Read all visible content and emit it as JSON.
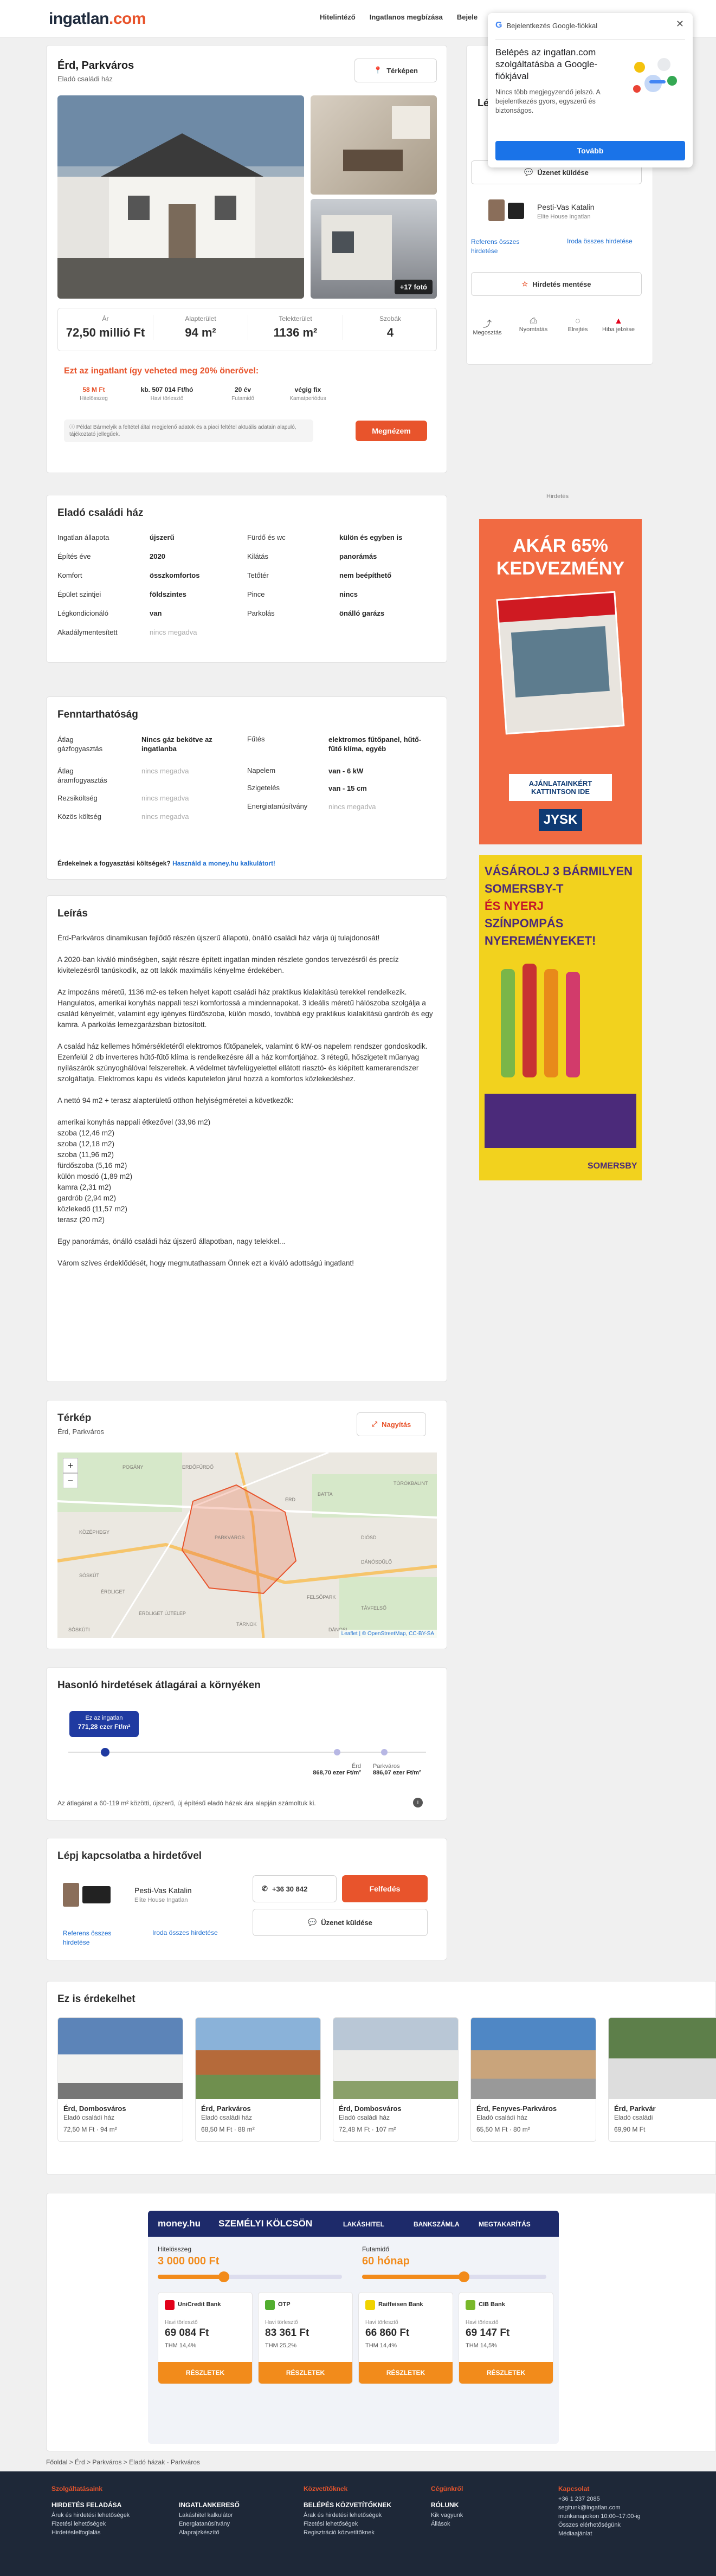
{
  "header": {
    "logo_main": "ingatlan",
    "logo_tld": ".com",
    "nav": [
      "Hitelintéző",
      "Ingatlanos megbízása",
      "Bejele"
    ]
  },
  "google_popup": {
    "brand": "Bejelentkezés Google-fiókkal",
    "title": "Belépés az ingatlan.com szolgáltatásba a Google-fiókjával",
    "body": "Nincs több megjegyzendő jelszó. A bejelentkezés gyors, egyszerű és biztonságos.",
    "button": "Tovább"
  },
  "listing": {
    "title": "Érd, Parkváros",
    "subtitle": "Eladó családi ház",
    "map_button": "Térképen",
    "more_photos": "+17 fotó",
    "stats": [
      {
        "label": "Ár",
        "value": "72,50 millió Ft"
      },
      {
        "label": "Alapterület",
        "value": "94 m²"
      },
      {
        "label": "Telekterület",
        "value": "1136 m²"
      },
      {
        "label": "Szobák",
        "value": "4"
      }
    ],
    "loan": {
      "headline": "Ezt az ingatlant így veheted meg 20% önerővel:",
      "items": [
        {
          "v": "58 M Ft",
          "l": "Hitelösszeg"
        },
        {
          "v": "kb. 507 014 Ft/hó",
          "l": "Havi törlesztő"
        },
        {
          "v": "20 év",
          "l": "Futamidő"
        },
        {
          "v": "végig fix",
          "l": "Kamatperiódus"
        }
      ],
      "note": "Példa! Bármelyik a feltétel által megjelenő adatok és a piaci feltétel aktuális adatain alapuló, tájékoztató jellegűek.",
      "button": "Megnézem"
    }
  },
  "sidebar": {
    "title": "Lépj",
    "message_button": "Üzenet küldése",
    "agent_name": "Pesti-Vas Katalin",
    "agent_company": "Elite House Ingatlan",
    "link_all": "Referens összes hirdetése",
    "link_office": "Iroda összes hirdetése",
    "save_button": "Hirdetés mentése",
    "actions": [
      "Megosztás",
      "Nyomtatás",
      "Elrejtés",
      "Hiba jelzése"
    ],
    "ad_label": "Hirdetés"
  },
  "ads": {
    "jysk_top": "AKÁR 65%",
    "jysk_sub": "KEDVEZMÉNY",
    "jysk_btn": "AJÁNLATAINKÉRT KATTINTSON IDE",
    "jysk_logo": "JYSK",
    "somersby_lines": [
      "VÁSÁROLJ 3 BÁRMILYEN",
      "SOMERSBY-T",
      "ÉS NYERJ",
      "SZÍNPOMPÁS",
      "NYEREMÉNYEKET!"
    ],
    "somersby_logo": "SOMERSBY"
  },
  "details": {
    "title": "Eladó családi ház",
    "left": [
      [
        "Ingatlan állapota",
        "újszerű"
      ],
      [
        "Építés éve",
        "2020"
      ],
      [
        "Komfort",
        "összkomfortos"
      ],
      [
        "Épület szintjei",
        "földszintes"
      ],
      [
        "Légkondicionáló",
        "van"
      ],
      [
        "Akadálymentesített",
        "nincs megadva"
      ]
    ],
    "right": [
      [
        "Fürdő és wc",
        "külön és egyben is"
      ],
      [
        "Kilátás",
        "panorámás"
      ],
      [
        "Tetőtér",
        "nem beépíthető"
      ],
      [
        "Pince",
        "nincs"
      ],
      [
        "Parkolás",
        "önálló garázs"
      ]
    ]
  },
  "maint": {
    "title": "Fenntarthatóság",
    "left": [
      [
        "Átlag gázfogyasztás",
        "Nincs gáz bekötve az ingatlanba"
      ],
      [
        "Átlag áramfogyasztás",
        "nincs megadva"
      ],
      [
        "Rezsiköltség",
        "nincs megadva"
      ],
      [
        "Közös költség",
        "nincs megadva"
      ]
    ],
    "right": [
      [
        "Fűtés",
        "elektromos fűtőpanel, hűtő-fűtő klíma, egyéb"
      ],
      [
        "Napelem",
        "van - 6 kW"
      ],
      [
        "Szigetelés",
        "van - 15 cm"
      ],
      [
        "Energiatanúsítvány",
        "nincs megadva"
      ]
    ],
    "q": "Érdekelnek a fogyasztási költségek?",
    "qlink": "Használd a money.hu kalkulátort!"
  },
  "description": {
    "title": "Leírás",
    "paras": [
      "Érd-Parkváros dinamikusan fejlődő részén újszerű állapotú, önálló családi ház várja új tulajdonosát!",
      "A 2020-ban kiváló minőségben, saját részre épített ingatlan minden részlete gondos tervezésről és precíz kivitelezésről tanúskodik, az ott lakók maximális kényelme érdekében.",
      "Az impozáns méretű, 1136 m2-es telken helyet kapott családi ház praktikus kialakítású terekkel rendelkezik. Hangulatos, amerikai konyhás nappali teszi komfortossá a mindennapokat. 3 ideális méretű hálószoba szolgálja a család kényelmét, valamint egy igényes fürdőszoba, külön mosdó, továbbá egy praktikus kialakítású gardrób és egy kamra. A parkolás lemezgarázsban biztosított.",
      "A család ház kellemes hőmérsékletéről elektromos fűtőpanelek, valamint 6 kW-os napelem rendszer gondoskodik. Ezenfelül 2 db inverteres hűtő-fűtő klíma is rendelkezésre áll a ház komfortjához. 3 rétegű, hőszigetelt műanyag nyílászárók szúnyoghálóval felszereltek. A védelmet távfelügyelettel ellátott riasztó- és kiépített kamerarendszer szolgáltatja. Elektromos kapu és videós kaputelefon járul hozzá a komfortos közlekedéshez.",
      "A nettó 94 m2 + terasz alapterületű otthon helyiségméretei a következők:"
    ],
    "rooms": [
      "amerikai konyhás nappali étkezővel (33,96 m2)",
      "szoba (12,46 m2)",
      "szoba (12,18 m2)",
      "szoba (11,96 m2)",
      "fürdőszoba (5,16 m2)",
      "külön mosdó (1,89 m2)",
      "kamra (2,31 m2)",
      "gardrób (2,94 m2)",
      "közlekedő (11,57 m2)",
      "terasz (20 m2)"
    ],
    "end": [
      "Egy panorámás, önálló családi ház újszerű állapotban, nagy telekkel...",
      "Várom szíves érdeklődését, hogy megmutathassam Önnek ezt a kiváló adottságú ingatlant!"
    ]
  },
  "map": {
    "title": "Térkép",
    "sub": "Érd, Parkváros",
    "button": "Nagyítás",
    "labels": [
      "PARKVÁROS",
      "ÉRD",
      "SÓSKÚT",
      "TÁRNOK",
      "BATTA",
      "DIÓSD",
      "DÁNÓSDŰLŐ",
      "ÉRDLIGET",
      "TÖRÖKBÁLINT",
      "ÉRDLIGET ÚJTELEP",
      "FELSŐPARK",
      "TÁVFELSŐ",
      "POGÁNY",
      "KÖZÉPHEGY",
      "ERDŐFÜRDŐ",
      "DÁNOSI",
      "SÓSKÚTI"
    ],
    "attribution": "Leaflet | © OpenStreetMap, CC-BY-SA"
  },
  "similar_price": {
    "title": "Hasonló hirdetések átlagárai a környéken",
    "tag1": "Ez az ingatlan",
    "tag2": "771,28 ezer Ft/m²",
    "p1_label": "Érd",
    "p1_value": "868,70 ezer Ft/m²",
    "p2_label": "Parkváros",
    "p2_value": "886,07 ezer Ft/m²",
    "note": "Az átlagárat a 60-119 m² közötti, újszerű, új építésű eladó házak ára alapján számoltuk ki."
  },
  "contact": {
    "title": "Lépj kapcsolatba a hirdetővel",
    "agent": "Pesti-Vas Katalin",
    "company": "Elite House Ingatlan",
    "phone": "+36 30 842",
    "reveal": "Felfedés",
    "message": "Üzenet küldése",
    "link_all": "Referens összes hirdetése",
    "link_office": "Iroda összes hirdetése"
  },
  "also": {
    "title": "Ez is érdekelhet",
    "cards": [
      {
        "t": "Érd, Dombosváros",
        "s": "Eladó családi ház",
        "p": "72,50 M Ft · 94 m²"
      },
      {
        "t": "Érd, Parkváros",
        "s": "Eladó családi ház",
        "p": "68,50 M Ft · 88 m²"
      },
      {
        "t": "Érd, Dombosváros",
        "s": "Eladó családi ház",
        "p": "72,48 M Ft · 107 m²"
      },
      {
        "t": "Érd, Fenyves-Parkváros",
        "s": "Eladó családi ház",
        "p": "65,50 M Ft · 80 m²"
      },
      {
        "t": "Érd, Parkvár",
        "s": "Eladó családi",
        "p": "69,90 M Ft"
      }
    ]
  },
  "money": {
    "brand": "money.hu",
    "title": "SZEMÉLYI KÖLCSÖN",
    "tabs": [
      "LAKÁSHITEL",
      "BANKSZÁMLA",
      "MEGTAKARÍTÁS"
    ],
    "amount_label": "Hitelösszeg",
    "amount": "3 000 000 Ft",
    "term_label": "Futamidő",
    "term": "60 hónap",
    "banks": [
      {
        "name": "UniCredit Bank",
        "rate": "69 084 Ft",
        "thm": "THM 14,4%",
        "color": "#e2001a"
      },
      {
        "name": "OTP",
        "rate": "83 361 Ft",
        "thm": "THM 25,2%",
        "color": "#52ae30"
      },
      {
        "name": "Raiffeisen Bank",
        "rate": "66 860 Ft",
        "thm": "THM 14,4%",
        "color": "#f0d300"
      },
      {
        "name": "CIB Bank",
        "rate": "69 147 Ft",
        "thm": "THM 14,5%",
        "color": "#79b82a"
      }
    ],
    "rate_label": "Havi törlesztő",
    "details": "RÉSZLETEK"
  },
  "breadcrumb": [
    "Főoldal",
    "Érd",
    "Parkváros",
    "Eladó házak - Parkváros"
  ],
  "footer": {
    "cols": [
      {
        "h": "Szolgáltatásaink",
        "items": []
      },
      {
        "h": "HIRDETÉS FELADÁSA",
        "items": [
          "Áruk és hirdetési lehetőségek",
          "Fizetési lehetőségek",
          "Hirdetésfelfoglalás"
        ]
      },
      {
        "h": "INGATLANKERESŐ",
        "items": [
          "Lakáshitel kalkulátor",
          "Energiatanúsítvány",
          "Alaprajzkészítő"
        ]
      },
      {
        "h": "Közvetítőknek",
        "items": []
      },
      {
        "h": "BELÉPÉS KÖZVETÍTŐKNEK",
        "items": [
          "Árak és hirdetési lehetőségek",
          "Fizetési lehetőségek",
          "Regisztráció közvetítőknek"
        ]
      },
      {
        "h": "Cégünkről",
        "items": []
      },
      {
        "h": "RÓLUNK",
        "items": [
          "Kik vagyunk",
          "Állások"
        ]
      },
      {
        "h": "Kapcsolat",
        "items": [
          "+36 1 237 2085",
          "segitunk@ingatlan.com",
          "munkanapokon 10:00–17:00-ig",
          "Összes elérhetőségünk",
          "Médiaajánlat"
        ]
      }
    ]
  }
}
